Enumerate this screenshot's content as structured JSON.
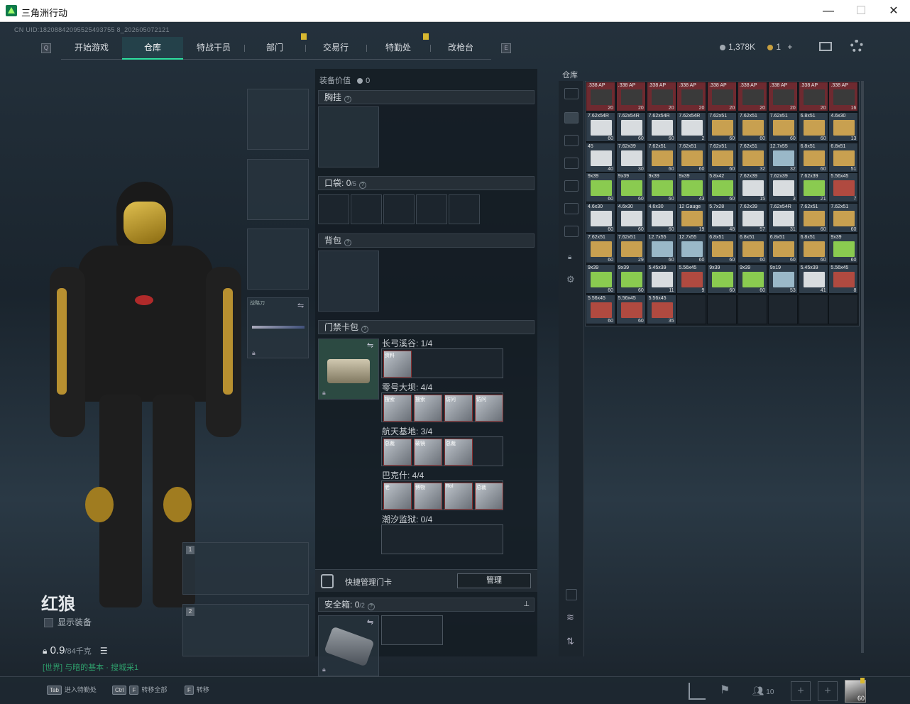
{
  "window": {
    "title": "三角洲行动",
    "minimize": "—",
    "maximize": "☐",
    "close": "✕"
  },
  "uid": "CN UID:18208842095525493755 8_202605072121",
  "nav": {
    "left_key": "Q",
    "right_key": "E",
    "tabs": [
      "开始游戏",
      "仓库",
      "特战干员",
      "部门",
      "交易行",
      "特勤处",
      "改枪台"
    ],
    "active": "仓库"
  },
  "currency": {
    "amount": "1,378K",
    "tickets": "1",
    "plus": "+"
  },
  "left": {
    "melee_label": "战略刀",
    "weapon1_num": "1",
    "weapon2_num": "2",
    "operator_name": "红狼",
    "show_equip": "显示装备",
    "weight_value": "0.9",
    "weight_max": "/84千克",
    "task_text": "[世界] 与暗的基本 · 搜城采1"
  },
  "middle": {
    "equip_value_label": "装备价值",
    "equip_value": "0",
    "chest_rig": "胸挂",
    "pockets_label": "口袋:",
    "pockets_count": "0",
    "pockets_max": "/5",
    "backpack": "背包",
    "keycard_bag": "门禁卡包",
    "maps": [
      {
        "name": "长弓溪谷: 1/4",
        "cards": [
          "资料"
        ]
      },
      {
        "name": "零号大坝: 4/4",
        "cards": [
          "搜索",
          "搜索",
          "访问",
          "访问"
        ]
      },
      {
        "name": "航天基地: 3/4",
        "cards": [
          "总裁",
          "破镜",
          "总裁"
        ]
      },
      {
        "name": "巴克什: 4/4",
        "cards": [
          "老",
          "博物",
          "Rol",
          "总裁"
        ]
      },
      {
        "name": "潮汐监狱: 0/4",
        "cards": []
      }
    ],
    "quick_manage": "快捷管理门卡",
    "manage_btn": "管理",
    "safebox_label": "安全箱:",
    "safebox_count": "0",
    "safebox_max": "/2"
  },
  "right": {
    "title": "仓库",
    "items": [
      {
        "l": ".338 AP",
        "c": "20",
        "k": "ap"
      },
      {
        "l": ".338 AP",
        "c": "20",
        "k": "ap"
      },
      {
        "l": ".338 AP",
        "c": "20",
        "k": "ap"
      },
      {
        "l": ".338 AP",
        "c": "20",
        "k": "ap"
      },
      {
        "l": ".338 AP",
        "c": "20",
        "k": "ap"
      },
      {
        "l": ".338 AP",
        "c": "20",
        "k": "ap"
      },
      {
        "l": ".338 AP",
        "c": "20",
        "k": "ap"
      },
      {
        "l": ".338 AP",
        "c": "20",
        "k": "ap"
      },
      {
        "l": ".338 AP",
        "c": "16",
        "k": "ap"
      },
      {
        "l": "7.62x54R",
        "c": "60",
        "k": "w"
      },
      {
        "l": "7.62x54R",
        "c": "60",
        "k": "w"
      },
      {
        "l": "7.62x54R",
        "c": "60",
        "k": "w"
      },
      {
        "l": "7.62x54R",
        "c": "2",
        "k": "w"
      },
      {
        "l": "7.62x51",
        "c": "60",
        "k": "y"
      },
      {
        "l": "7.62x51",
        "c": "60",
        "k": "y"
      },
      {
        "l": "7.62x51",
        "c": "60",
        "k": "y"
      },
      {
        "l": "6.8x51",
        "c": "60",
        "k": "y"
      },
      {
        "l": "4.6x30",
        "c": "13",
        "k": "y"
      },
      {
        "l": "45",
        "c": "40",
        "k": "w"
      },
      {
        "l": "7.62x39",
        "c": "30",
        "k": "w"
      },
      {
        "l": "7.62x51",
        "c": "60",
        "k": "y"
      },
      {
        "l": "7.62x51",
        "c": "60",
        "k": "y"
      },
      {
        "l": "7.62x51",
        "c": "60",
        "k": "y"
      },
      {
        "l": "7.62x51",
        "c": "32",
        "k": "y"
      },
      {
        "l": "12.7x55",
        "c": "32",
        "k": "b"
      },
      {
        "l": "6.8x51",
        "c": "60",
        "k": "y"
      },
      {
        "l": "6.8x51",
        "c": "51",
        "k": "y"
      },
      {
        "l": "9x39",
        "c": "60",
        "k": "g"
      },
      {
        "l": "9x39",
        "c": "60",
        "k": "g"
      },
      {
        "l": "9x39",
        "c": "60",
        "k": "g"
      },
      {
        "l": "9x39",
        "c": "43",
        "k": "g"
      },
      {
        "l": "5.8x42",
        "c": "60",
        "k": "g"
      },
      {
        "l": "7.62x39",
        "c": "15",
        "k": "w"
      },
      {
        "l": "7.62x39",
        "c": "3",
        "k": "w"
      },
      {
        "l": "7.62x39",
        "c": "21",
        "k": "g"
      },
      {
        "l": "5.56x45",
        "c": "7",
        "k": "r"
      },
      {
        "l": "4.6x30",
        "c": "60",
        "k": "w"
      },
      {
        "l": "4.6x30",
        "c": "60",
        "k": "w"
      },
      {
        "l": "4.6x30",
        "c": "60",
        "k": "w"
      },
      {
        "l": "12 Gauge",
        "c": "19",
        "k": "y"
      },
      {
        "l": "5.7x28",
        "c": "48",
        "k": "w"
      },
      {
        "l": "7.62x39",
        "c": "57",
        "k": "w"
      },
      {
        "l": "7.62x54R",
        "c": "31",
        "k": "w"
      },
      {
        "l": "7.62x51",
        "c": "60",
        "k": "y"
      },
      {
        "l": "7.62x51",
        "c": "60",
        "k": "y"
      },
      {
        "l": "7.62x51",
        "c": "60",
        "k": "y"
      },
      {
        "l": "7.62x51",
        "c": "29",
        "k": "y"
      },
      {
        "l": "12.7x55",
        "c": "60",
        "k": "b"
      },
      {
        "l": "12.7x55",
        "c": "60",
        "k": "b"
      },
      {
        "l": "6.8x51",
        "c": "60",
        "k": "y"
      },
      {
        "l": "6.8x51",
        "c": "60",
        "k": "y"
      },
      {
        "l": "6.8x51",
        "c": "60",
        "k": "y"
      },
      {
        "l": "6.8x51",
        "c": "60",
        "k": "y"
      },
      {
        "l": "9x39",
        "c": "60",
        "k": "g"
      },
      {
        "l": "9x39",
        "c": "60",
        "k": "g"
      },
      {
        "l": "9x39",
        "c": "60",
        "k": "g"
      },
      {
        "l": "5.45x39",
        "c": "11",
        "k": "w"
      },
      {
        "l": "5.56x45",
        "c": "9",
        "k": "r"
      },
      {
        "l": "9x39",
        "c": "60",
        "k": "g"
      },
      {
        "l": "9x39",
        "c": "60",
        "k": "g"
      },
      {
        "l": "9x19",
        "c": "53",
        "k": "b"
      },
      {
        "l": "5.45x39",
        "c": "41",
        "k": "w"
      },
      {
        "l": "5.56x45",
        "c": "8",
        "k": "r"
      },
      {
        "l": "5.56x45",
        "c": "60",
        "k": "r"
      },
      {
        "l": "5.56x45",
        "c": "60",
        "k": "r"
      },
      {
        "l": "5.56x45",
        "c": "35",
        "k": "r"
      }
    ]
  },
  "bottom": {
    "hint1_key": "Tab",
    "hint1": "进入特勤处",
    "hint2_key1": "Ctrl",
    "hint2_key2": "F",
    "hint2": "转移全部",
    "hint3_key": "F",
    "hint3": "转移",
    "friends_count": "10",
    "level": "60"
  },
  "colors": {
    "accent": "#2ee0a0",
    "ap_bg": "#7a2a2e",
    "cell_bg": "#2f3d4a"
  }
}
